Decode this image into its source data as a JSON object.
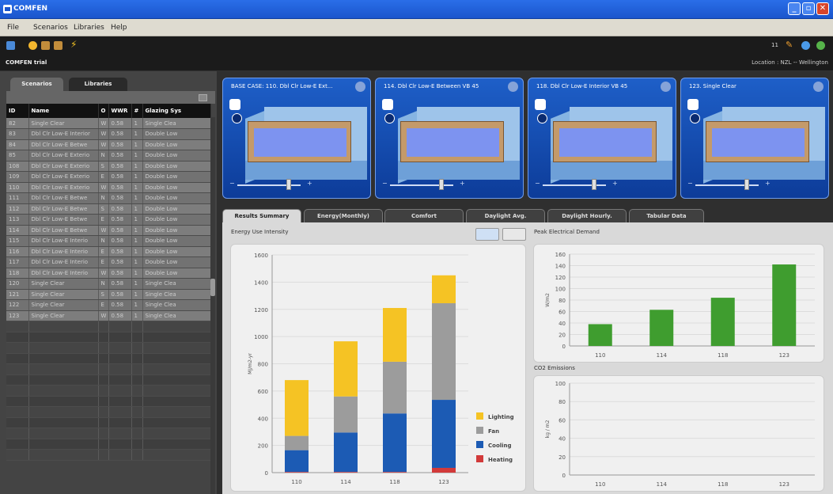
{
  "window": {
    "title": "COMFEN"
  },
  "menu": [
    "File",
    "Scenarios",
    "Libraries",
    "Help"
  ],
  "toolbar": {
    "counter": "11"
  },
  "info": {
    "app_subtitle": "COMFEN trial",
    "location": "Location :   NZL -- Wellington"
  },
  "left_tabs": [
    "Scenarios",
    "Libraries"
  ],
  "scenario_table": {
    "columns": [
      "ID",
      "Name",
      "O",
      "WWR",
      "#",
      "Glazing Sys"
    ],
    "rows": [
      [
        "82",
        "Single Clear",
        "W",
        "0.58",
        "1",
        "Single Clea"
      ],
      [
        "83",
        "Dbl Clr Low-E Interior",
        "W",
        "0.58",
        "1",
        "Double Low"
      ],
      [
        "84",
        "Dbl Clr Low-E Betwe",
        "W",
        "0.58",
        "1",
        "Double Low"
      ],
      [
        "85",
        "Dbl Clr Low-E Exterio",
        "N",
        "0.58",
        "1",
        "Double Low"
      ],
      [
        "108",
        "Dbl Clr Low-E Exterio",
        "S",
        "0.58",
        "1",
        "Double Low"
      ],
      [
        "109",
        "Dbl Clr Low-E Exterio",
        "E",
        "0.58",
        "1",
        "Double Low"
      ],
      [
        "110",
        "Dbl Clr Low-E Exterio",
        "W",
        "0.58",
        "1",
        "Double Low"
      ],
      [
        "111",
        "Dbl Clr Low-E Betwe",
        "N",
        "0.58",
        "1",
        "Double Low"
      ],
      [
        "112",
        "Dbl Clr Low-E Betwe",
        "S",
        "0.58",
        "1",
        "Double Low"
      ],
      [
        "113",
        "Dbl Clr Low-E Betwe",
        "E",
        "0.58",
        "1",
        "Double Low"
      ],
      [
        "114",
        "Dbl Clr Low-E Betwe",
        "W",
        "0.58",
        "1",
        "Double Low"
      ],
      [
        "115",
        "Dbl Clr Low-E Interio",
        "N",
        "0.58",
        "1",
        "Double Low"
      ],
      [
        "116",
        "Dbl Clr Low-E Interio",
        "E",
        "0.58",
        "1",
        "Double Low"
      ],
      [
        "117",
        "Dbl Clr Low-E Interio",
        "E",
        "0.58",
        "1",
        "Double Low"
      ],
      [
        "118",
        "Dbl Clr Low-E Interio",
        "W",
        "0.58",
        "1",
        "Double Low"
      ],
      [
        "120",
        "Single Clear",
        "N",
        "0.58",
        "1",
        "Single Clea"
      ],
      [
        "121",
        "Single Clear",
        "S",
        "0.58",
        "1",
        "Single Clea"
      ],
      [
        "122",
        "Single Clear",
        "E",
        "0.58",
        "1",
        "Single Clea"
      ],
      [
        "123",
        "Single Clear",
        "W",
        "0.58",
        "1",
        "Single Clea"
      ]
    ],
    "empty_rows": 13
  },
  "cards": [
    {
      "title": "BASE CASE: 110. Dbl Clr Low-E Ext..."
    },
    {
      "title": "114. Dbl Clr Low-E Between VB 45"
    },
    {
      "title": "118. Dbl Clr Low-E Interior VB 45"
    },
    {
      "title": "123. Single Clear"
    }
  ],
  "results_tabs": [
    "Results Summary",
    "Energy(Monthly)",
    "Comfort",
    "Daylight Avg.",
    "Daylight Hourly.",
    "Tabular Data"
  ],
  "colors": {
    "lighting": "#f5c324",
    "fan": "#9c9c9c",
    "cooling": "#1c5bb4",
    "heating": "#d23a3a",
    "peak": "#3f9d2f"
  },
  "chart_data": [
    {
      "type": "bar",
      "title": "Energy Use Intensity",
      "ylabel": "MJ/m2-yr",
      "categories": [
        "110",
        "114",
        "118",
        "123"
      ],
      "ylim": [
        0,
        1600
      ],
      "yticks": [
        "0",
        "200",
        "400",
        "600",
        "800",
        "1000",
        "1200",
        "1400",
        "1600"
      ],
      "series": [
        {
          "name": "Heating",
          "values": [
            5,
            5,
            5,
            35
          ]
        },
        {
          "name": "Cooling",
          "values": [
            160,
            290,
            430,
            500
          ]
        },
        {
          "name": "Fan",
          "values": [
            105,
            265,
            380,
            710
          ]
        },
        {
          "name": "Lighting",
          "values": [
            410,
            405,
            395,
            205
          ]
        }
      ],
      "legend": "right"
    },
    {
      "type": "bar",
      "title": "Peak Electrical Demand",
      "ylabel": "W/m2",
      "categories": [
        "110",
        "114",
        "118",
        "123"
      ],
      "ylim": [
        0,
        160
      ],
      "yticks": [
        "0",
        "20",
        "40",
        "60",
        "80",
        "100",
        "120",
        "140",
        "160"
      ],
      "values": [
        38,
        63,
        84,
        142
      ]
    },
    {
      "type": "bar",
      "title": "CO2 Emissions",
      "ylabel": "kg / m2",
      "categories": [
        "110",
        "114",
        "118",
        "123"
      ],
      "ylim": [
        0,
        100
      ],
      "yticks": [
        "0",
        "20",
        "40",
        "60",
        "80",
        "100"
      ],
      "values": []
    }
  ]
}
